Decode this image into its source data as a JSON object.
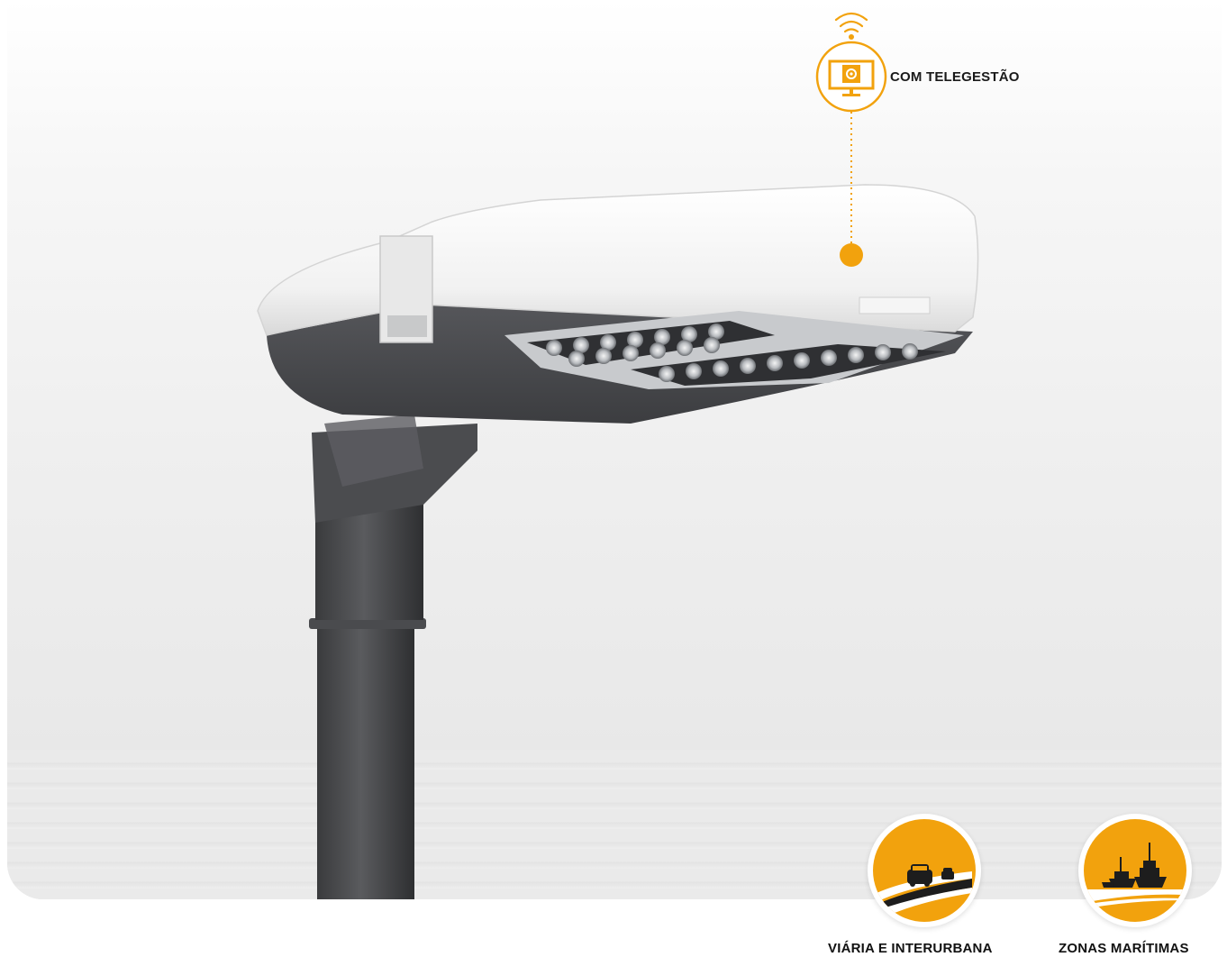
{
  "feature": {
    "label": "COM TELEGESTÃO",
    "icon": "wifi-monitor-gear-icon",
    "accent_color": "#f2a20d"
  },
  "applications": [
    {
      "label": "VIÁRIA E INTERURBANA",
      "icon": "road-cars-icon"
    },
    {
      "label": "ZONAS MARÍTIMAS",
      "icon": "ships-harbor-icon"
    }
  ]
}
